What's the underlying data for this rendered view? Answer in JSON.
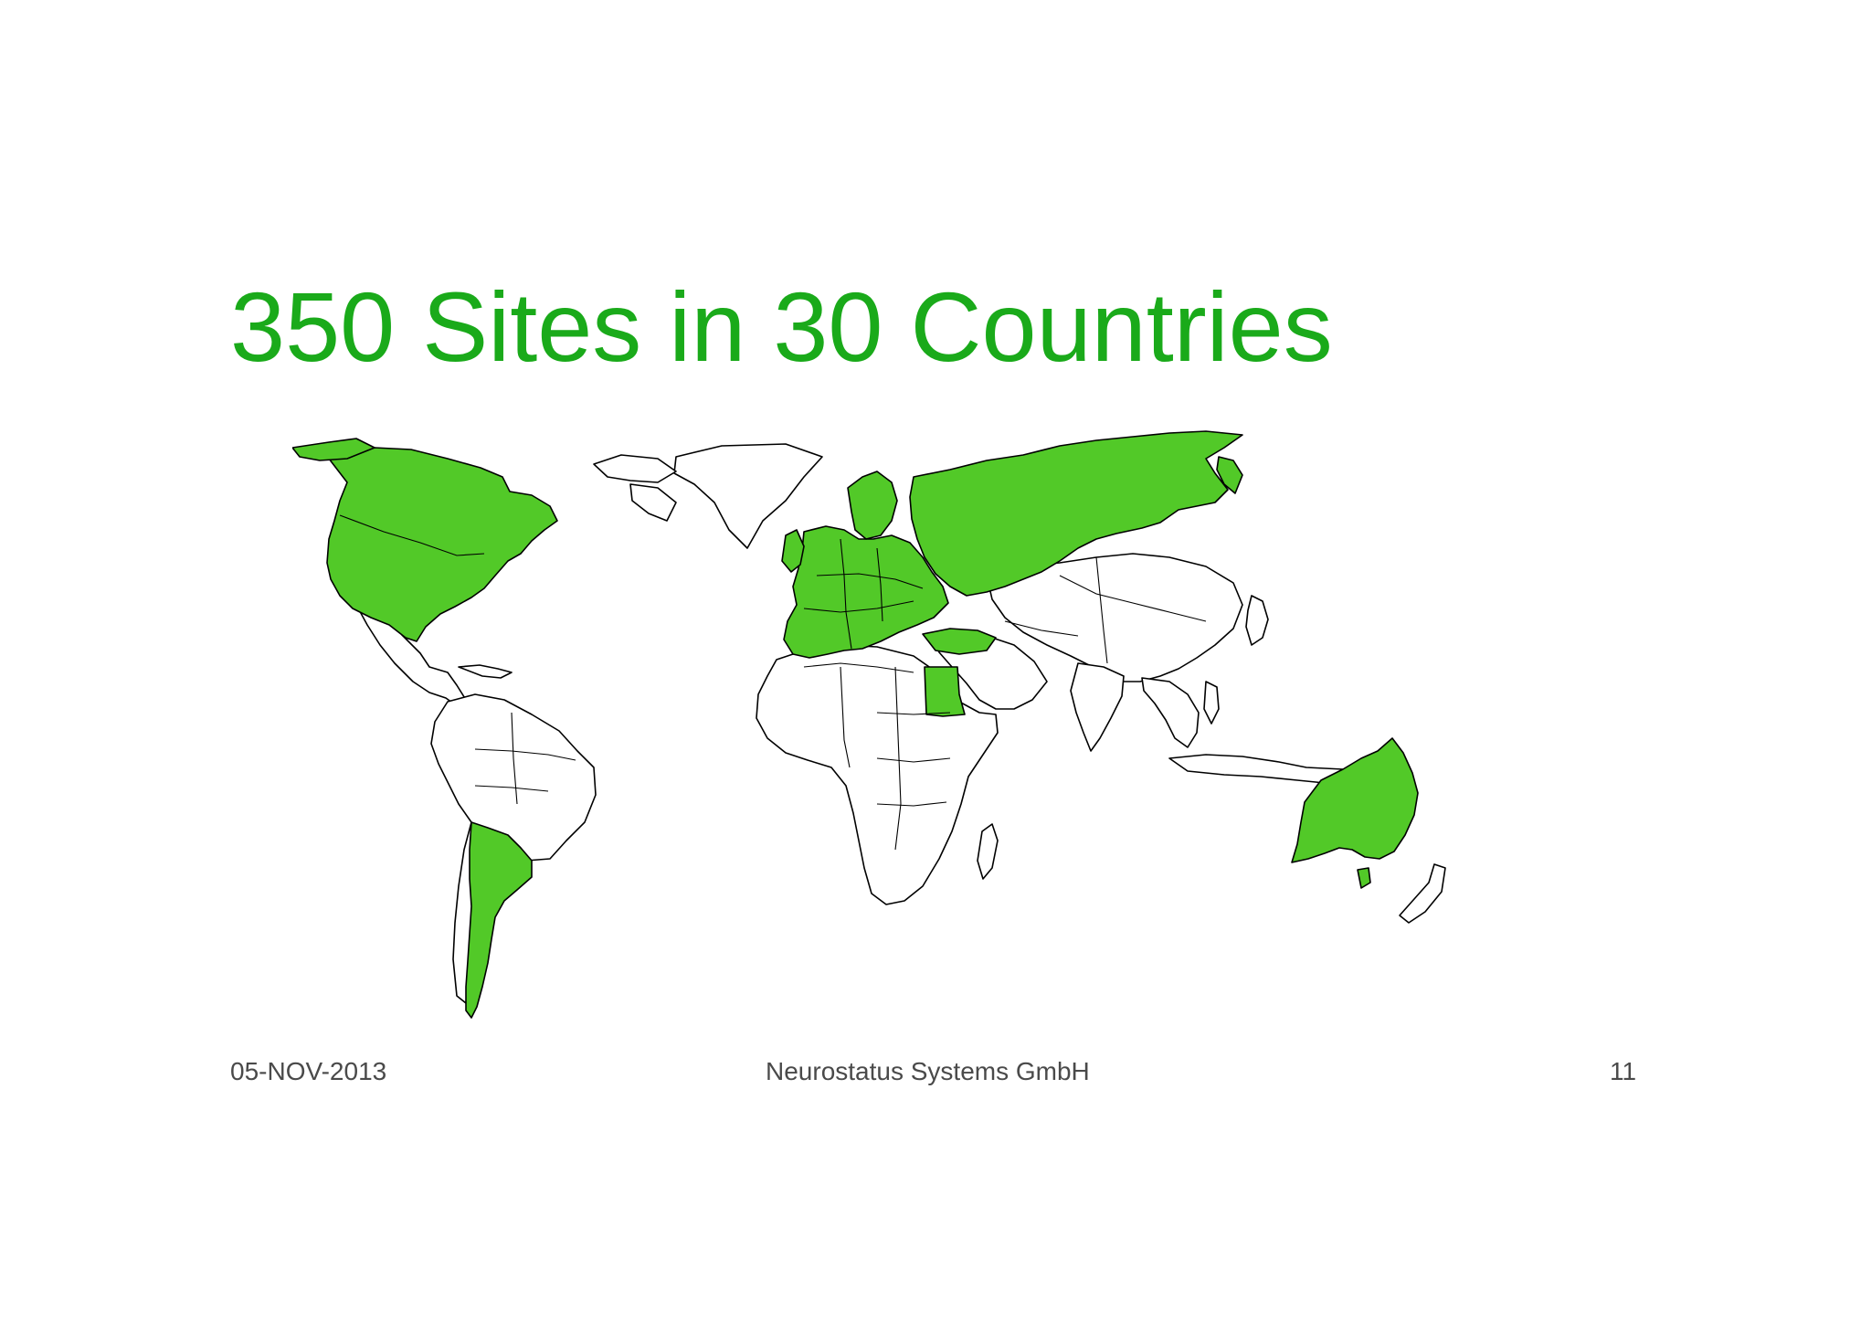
{
  "slide": {
    "title": "350 Sites in 30 Countries",
    "footer": {
      "date": "05-NOV-2013",
      "company": "Neurostatus Systems GmbH",
      "page_number": "11"
    }
  },
  "map": {
    "highlight_color": "#52c928",
    "base_color": "#ffffff",
    "outline_color": "#000000"
  }
}
